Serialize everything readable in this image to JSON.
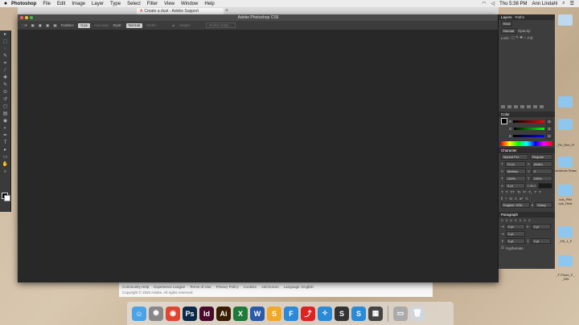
{
  "menubar": {
    "apple": "",
    "items": [
      "Photoshop",
      "File",
      "Edit",
      "Image",
      "Layer",
      "Type",
      "Select",
      "Filter",
      "View",
      "Window",
      "Help"
    ],
    "clock": "Thu 5:38 PM",
    "user": "Ann Lindahl"
  },
  "browser": {
    "tab_title": "Create a dust - Adobe Support",
    "new_tab": "+"
  },
  "webfooter": {
    "links": [
      "Community Help",
      "Experience League",
      "Terms of Use",
      "Privacy Policy",
      "Cookies",
      "AdChoices",
      "Language: English"
    ],
    "copyright": "Copyright © 2020 Adobe. All rights reserved."
  },
  "photoshop": {
    "window_title": "Adobe Photoshop CS6",
    "options": {
      "feather_label": "Feather:",
      "feather_value": "0 px",
      "anti_alias": "Anti-alias",
      "style_label": "Style:",
      "style_value": "Normal",
      "width_label": "Width:",
      "height_label": "Height:",
      "refine_edge": "Refine Edge..."
    },
    "tool_icons": [
      "move-icon",
      "marquee-icon",
      "lasso-icon",
      "quick-select-icon",
      "crop-icon",
      "eyedropper-icon",
      "healing-icon",
      "brush-icon",
      "stamp-icon",
      "history-brush-icon",
      "eraser-icon",
      "gradient-icon",
      "blur-icon",
      "dodge-icon",
      "pen-icon",
      "type-icon",
      "path-select-icon",
      "shape-icon",
      "hand-icon",
      "zoom-icon"
    ],
    "tool_glyphs": [
      "▸",
      "⬚",
      "◌",
      "✎",
      "⌗",
      "⁄",
      "✚",
      "✎",
      "⊙",
      "↺",
      "◻",
      "▤",
      "◉",
      "◐",
      "✒",
      "T",
      "▸",
      "▭",
      "✋",
      "⌕"
    ],
    "layers_panel": {
      "tabs": [
        "Layers",
        "Paths"
      ],
      "kind": "Kind",
      "blend": "Normal",
      "opacity_label": "Opacity:",
      "lock_label": "Lock:",
      "fill_label": "Fill:"
    },
    "color_panel": {
      "title": "Color",
      "channels": [
        {
          "name": "R",
          "value": "0"
        },
        {
          "name": "G",
          "value": "0"
        },
        {
          "name": "B",
          "value": "0"
        }
      ]
    },
    "character_panel": {
      "title": "Character",
      "font": "Myriad Pro",
      "style": "Regular",
      "size": "12 pt",
      "leading": "(Auto)",
      "kerning": "Metrics",
      "tracking": "0",
      "vscale": "100%",
      "hscale": "100%",
      "baseline": "0 pt",
      "color_label": "Color:",
      "language": "English: USA",
      "aa": "Sharp"
    },
    "paragraph_panel": {
      "title": "Paragraph",
      "indent_left": "0 pt",
      "indent_right": "0 pt",
      "indent_first": "0 pt",
      "space_before": "0 pt",
      "space_after": "0 pt",
      "hyphenate": "Hyphenate"
    }
  },
  "desktop_labels": [
    "_Fin_Rev_Fi",
    "handouts Shaw",
    "ook_Pfef ook_Rest",
    "_FN_1_F",
    "_F Photo_F_ _026"
  ],
  "dock": [
    {
      "name": "finder-icon",
      "glyph": "☺",
      "color": "#4aa3e8"
    },
    {
      "name": "launchpad-icon",
      "glyph": "✺",
      "color": "#888"
    },
    {
      "name": "chrome-icon",
      "glyph": "◉",
      "color": "#e0452f"
    },
    {
      "name": "photoshop-icon",
      "glyph": "Ps",
      "color": "#0b2a4a"
    },
    {
      "name": "indesign-icon",
      "glyph": "Id",
      "color": "#4a0a2a"
    },
    {
      "name": "illustrator-icon",
      "glyph": "Ai",
      "color": "#3a1d00"
    },
    {
      "name": "excel-icon",
      "glyph": "X",
      "color": "#1e7a3a"
    },
    {
      "name": "word-icon",
      "glyph": "W",
      "color": "#2b5aa8"
    },
    {
      "name": "sketch-icon",
      "glyph": "S",
      "color": "#f2a92a"
    },
    {
      "name": "fontbook-icon",
      "glyph": "F",
      "color": "#2a8ad8"
    },
    {
      "name": "acrobat-icon",
      "glyph": "⤴",
      "color": "#d22"
    },
    {
      "name": "safari-icon",
      "glyph": "✧",
      "color": "#2a8ad8"
    },
    {
      "name": "sync-icon",
      "glyph": "S",
      "color": "#333"
    },
    {
      "name": "skype-icon",
      "glyph": "S",
      "color": "#2a8ad8"
    },
    {
      "name": "printer-icon",
      "glyph": "▦",
      "color": "#444"
    },
    {
      "name": "preview-icon",
      "glyph": "▭",
      "color": "#aaa"
    },
    {
      "name": "trash-icon",
      "glyph": "🗑",
      "color": "#cfd6dc"
    }
  ]
}
